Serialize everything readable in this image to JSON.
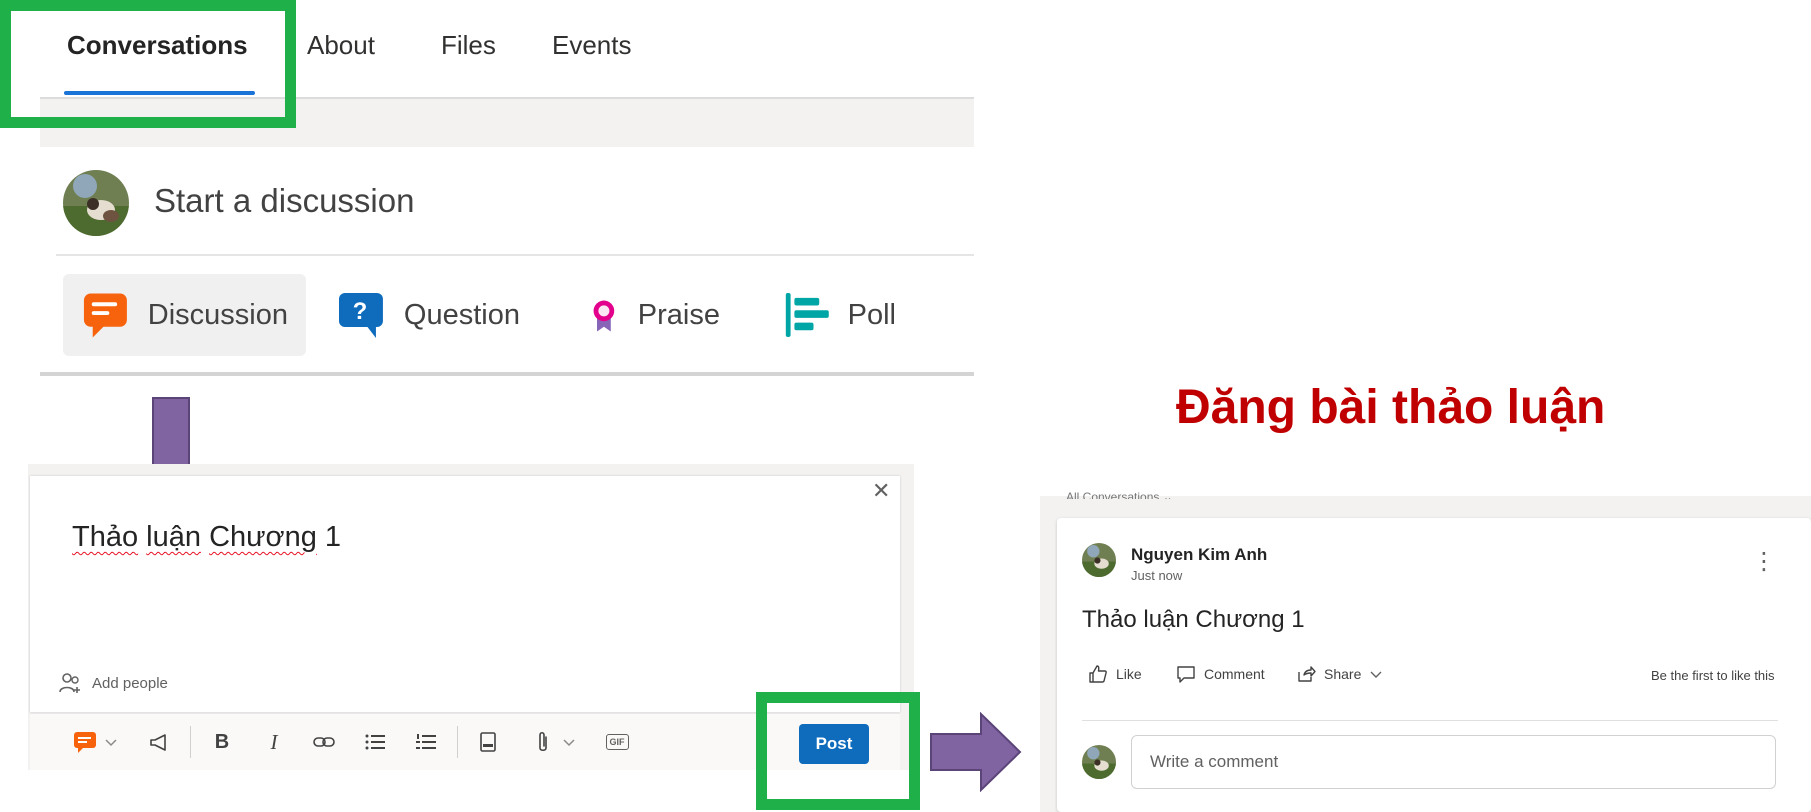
{
  "tabs": [
    {
      "label": "Conversations",
      "active": true
    },
    {
      "label": "About"
    },
    {
      "label": "Files"
    },
    {
      "label": "Events"
    }
  ],
  "composer": {
    "prompt": "Start a discussion",
    "post_types": [
      {
        "label": "Discussion",
        "icon": "discussion-icon",
        "color": "#f7630c",
        "selected": true
      },
      {
        "label": "Question",
        "icon": "question-icon",
        "color": "#0f6cbd"
      },
      {
        "label": "Praise",
        "icon": "praise-badge-icon",
        "color": "#c239b3"
      },
      {
        "label": "Poll",
        "icon": "poll-icon",
        "color": "#00a5a5"
      }
    ]
  },
  "annotation": {
    "heading": "Đăng bài thảo luận",
    "heading_color": "#c00000",
    "highlight_color": "#1fb04a",
    "arrow_color": "#8064a2"
  },
  "editor": {
    "text_parts": [
      "Thảo",
      " ",
      "luận",
      " ",
      "Chương",
      " 1"
    ],
    "close_icon": "close-icon",
    "add_people_label": "Add people",
    "toolbar": {
      "post_type_icon": "discussion-icon",
      "announcement_icon": "megaphone-icon",
      "bold": "B",
      "italic": "I",
      "link_icon": "link-icon",
      "bullets_icon": "bulleted-list-icon",
      "numbered_icon": "numbered-list-icon",
      "book_icon": "book-icon",
      "attach_icon": "paperclip-icon",
      "gif": "GIF"
    },
    "post_label": "Post",
    "post_color": "#0f6cbd"
  },
  "posted": {
    "filter_label": "All Conversations",
    "author": "Nguyen Kim Anh",
    "time": "Just now",
    "body": "Thảo luận Chương 1",
    "actions": {
      "like": "Like",
      "comment": "Comment",
      "share": "Share"
    },
    "like_status": "Be the first to like this",
    "comment_placeholder": "Write a comment"
  }
}
